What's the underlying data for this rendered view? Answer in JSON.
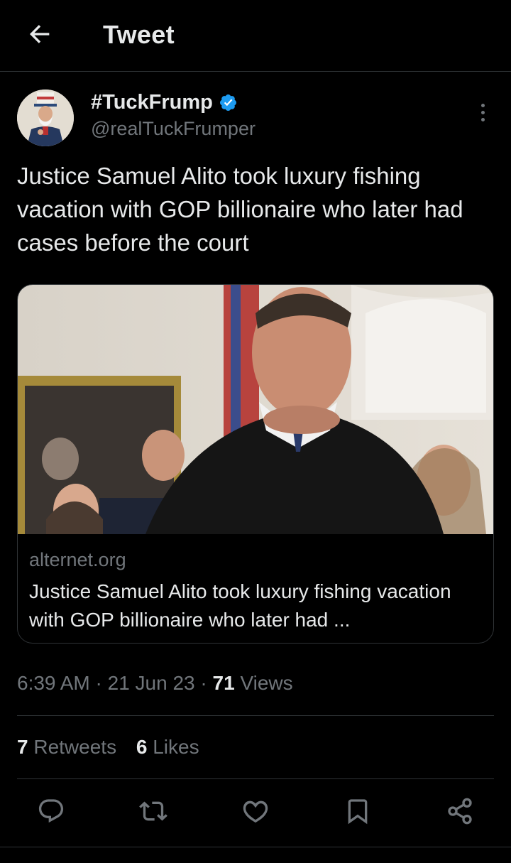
{
  "header": {
    "title": "Tweet",
    "back_icon": "arrow-left-icon"
  },
  "author": {
    "display_name": "#TuckFrump",
    "handle": "@realTuckFrumper",
    "verified": true,
    "verified_color": "#1d9bf0"
  },
  "tweet": {
    "text": "Justice Samuel Alito took luxury fishing vacation with GOP billionaire who later had cases before the court"
  },
  "card": {
    "domain": "alternet.org",
    "title": "Justice Samuel Alito took luxury fishing vacation with GOP billionaire who later had ..."
  },
  "meta": {
    "time": "6:39 AM",
    "separator": " · ",
    "date": "21 Jun 23",
    "views_count": "71",
    "views_label": " Views"
  },
  "stats": {
    "retweets_count": "7",
    "retweets_label": " Retweets",
    "likes_count": "6",
    "likes_label": " Likes"
  },
  "actions": [
    "reply-icon",
    "retweet-icon",
    "like-icon",
    "bookmark-icon",
    "share-icon"
  ],
  "colors": {
    "background": "#000000",
    "text": "#e7e9ea",
    "secondary": "#71767b",
    "border": "#2f3336",
    "accent": "#1d9bf0"
  }
}
